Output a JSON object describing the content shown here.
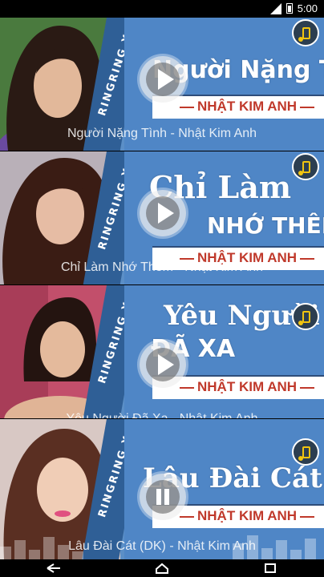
{
  "status_bar": {
    "time": "5:00"
  },
  "stripe_label": "RINGRING X STORE",
  "cards": [
    {
      "title_line1": "Người Nặng Tình",
      "title_line2": "",
      "artist": "NHẬT KIM ANH",
      "caption": "Người Nặng Tình - Nhật Kim Anh",
      "state": "play",
      "photo_bg": "#6b4a3b",
      "photo_accent": "#3a7a3a"
    },
    {
      "title_line1": "Chỉ Làm",
      "title_line2": "NHỚ THÊM",
      "artist": "NHẬT KIM ANH",
      "caption": "Chỉ Làm Nhớ Thêm - Nhật Kim Anh",
      "state": "play",
      "photo_bg": "#8a5c63",
      "photo_accent": "#7a5aa8"
    },
    {
      "title_line1": "Yêu Người",
      "title_line2": "ĐÃ XA",
      "artist": "NHẬT KIM ANH",
      "caption": "Yêu Người Đã Xa - Nhật Kim Anh",
      "state": "play",
      "photo_bg": "#c24f6b",
      "photo_accent": "#d9a48a"
    },
    {
      "title_line1": "Lâu Đài Cát",
      "title_line2": "",
      "artist": "NHẬT KIM ANH",
      "caption": "Lâu Đài Cát (DK) - Nhật Kim Anh",
      "state": "pause",
      "photo_bg": "#c9b6b0",
      "photo_accent": "#e6d2c8"
    }
  ],
  "nav": {
    "back_icon": "back-icon",
    "home_icon": "home-icon",
    "recents_icon": "recents-icon"
  }
}
